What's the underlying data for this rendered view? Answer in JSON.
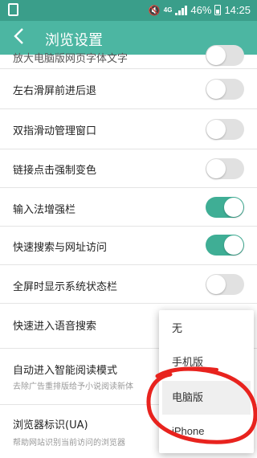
{
  "status_bar": {
    "battery_percent": "46%",
    "time": "14:25",
    "network": "4G"
  },
  "appbar": {
    "title": "浏览设置"
  },
  "settings": {
    "partial_top": "放大电脑版网页字体文字",
    "items": [
      {
        "label": "左右滑屏前进后退",
        "toggle": false
      },
      {
        "label": "双指滑动管理窗口",
        "toggle": false
      },
      {
        "label": "链接点击强制变色",
        "toggle": false
      },
      {
        "label": "输入法增强栏",
        "toggle": true
      },
      {
        "label": "快速搜索与网址访问",
        "toggle": true
      },
      {
        "label": "全屏时显示系统状态栏",
        "toggle": false
      },
      {
        "label": "快速进入语音搜索"
      },
      {
        "label": "自动进入智能阅读模式",
        "sub": "去除广告重排版给予小说阅读新体"
      },
      {
        "label": "浏览器标识(UA)",
        "sub": "帮助网站识别当前访问的浏览器"
      }
    ]
  },
  "ua_menu": {
    "options": [
      "无",
      "手机版",
      "电脑版",
      "iPhone"
    ],
    "highlighted": "电脑版"
  },
  "colors": {
    "accent": "#4cb6a2",
    "status_bar": "#3a9e8a",
    "toggle_on": "#3fae95",
    "annotation": "#e8231e"
  }
}
